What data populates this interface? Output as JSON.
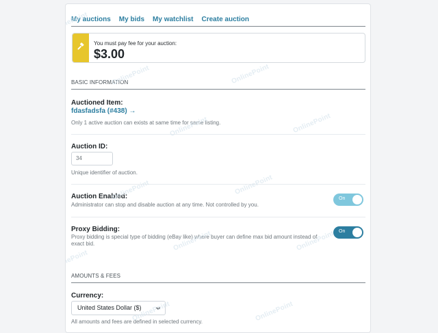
{
  "tabs": [
    {
      "label": "My auctions"
    },
    {
      "label": "My bids"
    },
    {
      "label": "My watchlist"
    },
    {
      "label": "Create auction"
    }
  ],
  "fee": {
    "notice": "You must pay fee for your auction:",
    "amount": "$3.00"
  },
  "sections": {
    "basic": {
      "title": "BASIC INFORMATION"
    },
    "amounts": {
      "title": "AMOUNTS & FEES"
    }
  },
  "fields": {
    "auctioned_item": {
      "label": "Auctioned Item:",
      "link_text": "fdasfadsfa (#438) →",
      "help": "Only 1 active auction can exists at same time for same listing."
    },
    "auction_id": {
      "label": "Auction ID:",
      "value": "34",
      "help": "Unique identifier of auction."
    },
    "auction_enabled": {
      "label": "Auction Enabled:",
      "help": "Administrator can stop and disable auction at any time. Not controlled by you.",
      "toggle_text": "On",
      "toggle_color": "#7fc7dd"
    },
    "proxy_bidding": {
      "label": "Proxy Bidding:",
      "help": "Proxy bidding is special type of bidding (eBay like) where buyer can define max bid amount instead of exact bid.",
      "toggle_text": "On",
      "toggle_color": "#2c7ea0"
    },
    "currency": {
      "label": "Currency:",
      "selected": "United States Dollar ($)",
      "help": "All amounts and fees are defined in selected currency."
    }
  },
  "watermark": {
    "text": "OnlinePoint"
  },
  "colors": {
    "accent": "#2c7ea0",
    "fee_strip": "#e7c62c"
  }
}
